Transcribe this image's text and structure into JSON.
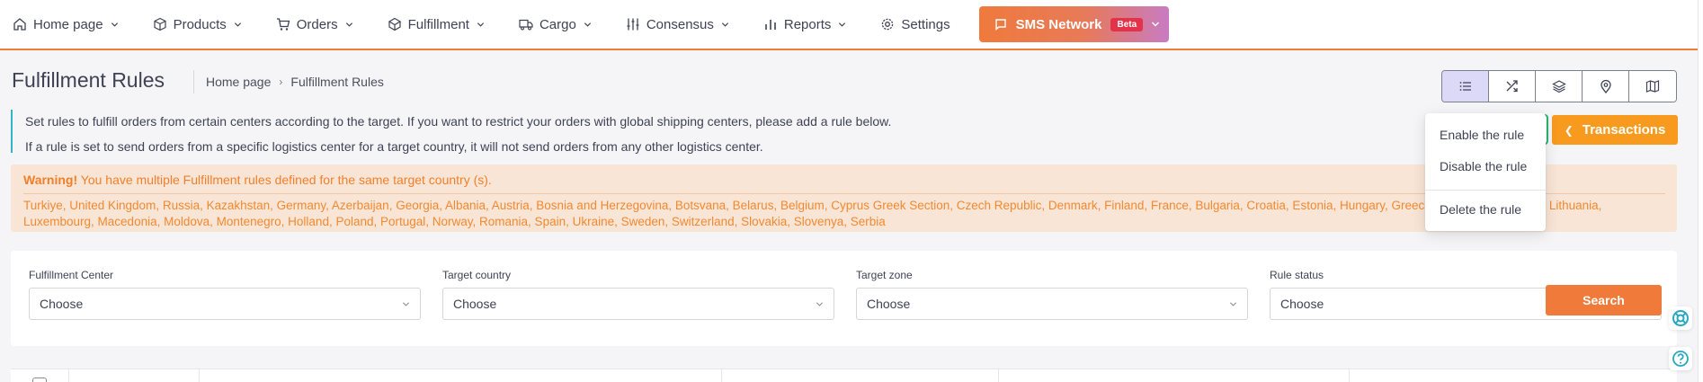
{
  "nav": {
    "items": [
      {
        "label": "Home page",
        "icon": "home-icon"
      },
      {
        "label": "Products",
        "icon": "box-icon"
      },
      {
        "label": "Orders",
        "icon": "cart-icon"
      },
      {
        "label": "Fulfillment",
        "icon": "package-icon"
      },
      {
        "label": "Cargo",
        "icon": "truck-icon"
      },
      {
        "label": "Consensus",
        "icon": "sliders-icon"
      },
      {
        "label": "Reports",
        "icon": "bar-chart-icon"
      },
      {
        "label": "Settings",
        "icon": "gear-icon"
      }
    ],
    "sms": {
      "label": "SMS Network",
      "badge": "Beta",
      "icon": "sms-icon"
    },
    "accent": "#ef7d3a"
  },
  "page": {
    "title": "Fulfillment Rules",
    "breadcrumb": [
      "Home page",
      "Fulfillment Rules"
    ],
    "breadcrumb_separator": "›"
  },
  "view_buttons": [
    {
      "icon": "list-icon",
      "active": true
    },
    {
      "icon": "shuffle-icon",
      "active": false
    },
    {
      "icon": "layers-icon",
      "active": false
    },
    {
      "icon": "map-pin-icon",
      "active": false
    },
    {
      "icon": "map-icon",
      "active": false
    }
  ],
  "info": {
    "line1": "Set rules to fulfill orders from certain centers according to the target. If you want to restrict your orders with global shipping centers, please add a rule below.",
    "line2": "If a rule is set to send orders from a specific logistics center for a target country, it will not send orders from any other logistics center."
  },
  "actions": {
    "transactions": "Transactions",
    "dropdown": [
      "Enable the rule",
      "Disable the rule",
      "Delete the rule"
    ]
  },
  "warning": {
    "title_bold": "Warning!",
    "title_rest": " You have multiple Fulfillment rules defined for the same target country (s).",
    "countries": "Turkiye, United Kingdom, Russia, Kazakhstan, Germany, Azerbaijan, Georgia, Albania, Austria, Bosnia and Herzegovina, Botsvana, Belarus, Belgium, Cyprus Greek Section, Czech Republic, Denmark, Finland, France, Bulgaria, Croatia, Estonia, Hungary, Greece, Ireland, Italy, Latvia, Lithuania, Luxembourg, Macedonia, Moldova, Montenegro, Holland, Poland, Portugal, Norway, Romania, Spain, Ukraine, Sweden, Switzerland, Slovakia, Slovenya, Serbia",
    "color": "#f17f2a"
  },
  "filters": [
    {
      "label": "Fulfillment Center",
      "value": "Choose"
    },
    {
      "label": "Target country",
      "value": "Choose"
    },
    {
      "label": "Target zone",
      "value": "Choose"
    },
    {
      "label": "Rule status",
      "value": "Choose"
    }
  ],
  "search_button": "Search"
}
